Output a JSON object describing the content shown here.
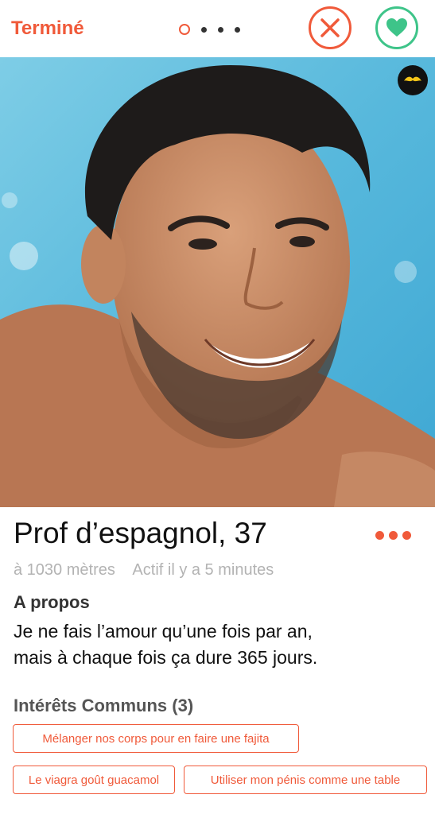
{
  "header": {
    "done_label": "Terminé",
    "page_indicator": {
      "total": 4,
      "current": 1
    },
    "nope_icon": "close-icon",
    "like_icon": "heart-icon",
    "accent_color": "#f05a3a",
    "like_color": "#3ec489"
  },
  "photo": {
    "badge_icon": "mustache-icon"
  },
  "profile": {
    "name_age": "Prof d’espagnol, 37",
    "distance": "à 1030 mètres",
    "active": "Actif il y a 5 minutes",
    "more_icon": "more-dots-icon"
  },
  "about": {
    "title": "A propos",
    "line1": "Je ne fais l’amour qu’une fois par an,",
    "line2": "mais à chaque fois ça dure 365 jours."
  },
  "interests": {
    "title": "Intérêts Communs (3)",
    "items": [
      "Mélanger nos corps pour en faire une fajita",
      "Le viagra goût guacamol",
      "Utiliser mon pénis comme une table"
    ]
  }
}
